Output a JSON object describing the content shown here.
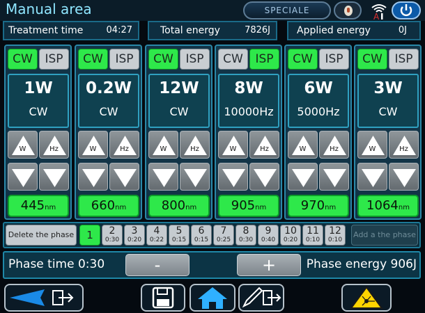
{
  "title": "Manual area",
  "mode": "SPECIALE",
  "info": {
    "treatment_time_label": "Treatment time",
    "treatment_time": "04:27",
    "total_energy_label": "Total energy",
    "total_energy": "7826J",
    "applied_energy_label": "Applied energy",
    "applied_energy": "0J"
  },
  "buttons": {
    "cw": "CW",
    "isp": "ISP",
    "w": "W",
    "hz": "Hz",
    "unit_nm": "nm",
    "delete_phase": "Delete the phase",
    "add_phase": "Add a the phase",
    "minus": "-",
    "plus": "+"
  },
  "channels": [
    {
      "power": "1W",
      "freq": "CW",
      "wavelength": "445",
      "mode": "CW"
    },
    {
      "power": "0.2W",
      "freq": "CW",
      "wavelength": "660",
      "mode": "CW"
    },
    {
      "power": "12W",
      "freq": "CW",
      "wavelength": "800",
      "mode": "CW"
    },
    {
      "power": "8W",
      "freq": "10000Hz",
      "wavelength": "905",
      "mode": "ISP"
    },
    {
      "power": "6W",
      "freq": "5000Hz",
      "wavelength": "970",
      "mode": "CW"
    },
    {
      "power": "3W",
      "freq": "CW",
      "wavelength": "1064",
      "mode": "CW"
    }
  ],
  "phases": [
    {
      "num": "1",
      "time": "",
      "active": true
    },
    {
      "num": "2",
      "time": "0:30"
    },
    {
      "num": "3",
      "time": "0:20"
    },
    {
      "num": "4",
      "time": "0:22"
    },
    {
      "num": "5",
      "time": "0:15"
    },
    {
      "num": "6",
      "time": "0:15"
    },
    {
      "num": "7",
      "time": "0:25"
    },
    {
      "num": "8",
      "time": "0:30"
    },
    {
      "num": "9",
      "time": "0:40"
    },
    {
      "num": "10",
      "time": "0:20"
    },
    {
      "num": "11",
      "time": "0:10"
    },
    {
      "num": "12",
      "time": "0:10"
    }
  ],
  "phase_time": "Phase time 0:30",
  "phase_energy": "Phase energy 906J",
  "colors": {
    "accent_green": "#2ee84a",
    "title_blue": "#8fe6ff",
    "power_blue": "#0c5aa8",
    "laser_yellow": "#ffd400"
  },
  "icons": {
    "back": "arrow-left-icon",
    "exit": "exit-door-icon",
    "save": "floppy-disk-icon",
    "home": "home-icon",
    "edit": "pencil-icon",
    "laser": "laser-warning-icon",
    "wifi": "wifi-icon",
    "power": "power-icon",
    "mic": "microphone-icon"
  }
}
